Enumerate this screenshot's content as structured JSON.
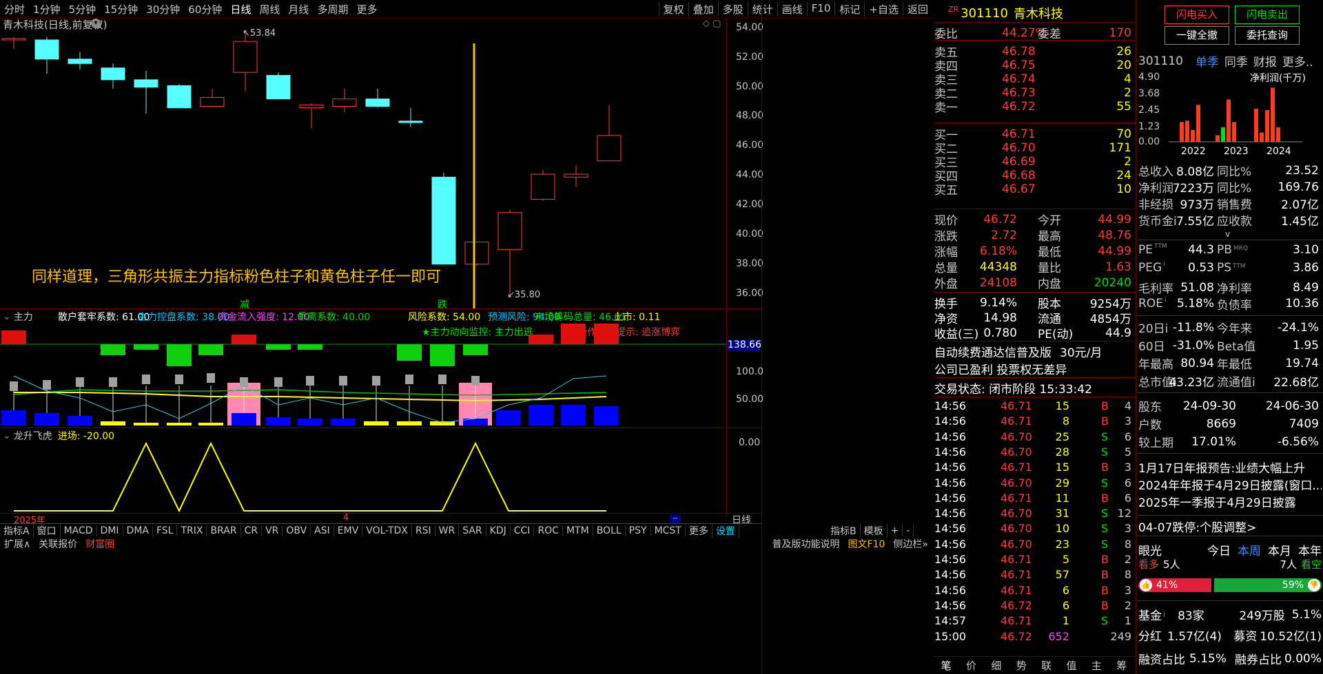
{
  "topbar": {
    "periods": [
      "分时",
      "1分钟",
      "5分钟",
      "15分钟",
      "30分钟",
      "60分钟",
      "日线",
      "周线",
      "月线",
      "多周期",
      "更多"
    ],
    "tools": [
      "复权",
      "叠加",
      "多股",
      "统计",
      "画线",
      "F10",
      "标记",
      "+自选",
      "返回"
    ]
  },
  "chart": {
    "title": "青木科技(日线,前复权)",
    "price_ticks": [
      "54.00",
      "52.00",
      "50.00",
      "48.00",
      "46.00",
      "44.00",
      "42.00",
      "40.00",
      "38.00",
      "36.00"
    ],
    "high_label": "53.84",
    "low_label": "35.80",
    "annotation": "同样道理，三角形共振主力指标粉色柱子和黄色柱子任一即可",
    "marker_jian": "减",
    "marker_die": "跌",
    "candles": [
      {
        "o": 53.2,
        "c": 53.3,
        "h": 53.4,
        "l": 52.6,
        "bull": true
      },
      {
        "o": 53.2,
        "c": 51.9,
        "h": 53.4,
        "l": 50.9,
        "bull": false
      },
      {
        "o": 51.9,
        "c": 51.6,
        "h": 52.4,
        "l": 51.2,
        "bull": false
      },
      {
        "o": 51.3,
        "c": 50.5,
        "h": 51.6,
        "l": 49.9,
        "bull": false
      },
      {
        "o": 50.5,
        "c": 50.0,
        "h": 51.1,
        "l": 48.2,
        "bull": false
      },
      {
        "o": 50.1,
        "c": 48.6,
        "h": 50.2,
        "l": 48.6,
        "bull": false
      },
      {
        "o": 48.7,
        "c": 49.3,
        "h": 49.9,
        "l": 48.7,
        "bull": true
      },
      {
        "o": 51.0,
        "c": 53.1,
        "h": 53.84,
        "l": 49.7,
        "bull": true
      },
      {
        "o": 50.8,
        "c": 49.2,
        "h": 51.0,
        "l": 49.2,
        "bull": false
      },
      {
        "o": 48.6,
        "c": 48.8,
        "h": 48.9,
        "l": 47.2,
        "bull": true
      },
      {
        "o": 48.7,
        "c": 49.2,
        "h": 49.9,
        "l": 48.3,
        "bull": true
      },
      {
        "o": 49.2,
        "c": 48.7,
        "h": 49.9,
        "l": 48.6,
        "bull": false
      },
      {
        "o": 47.7,
        "c": 47.6,
        "h": 48.6,
        "l": 47.3,
        "bull": false
      },
      {
        "o": 43.9,
        "c": 38.0,
        "h": 44.2,
        "l": 38.0,
        "bull": false
      },
      {
        "o": 38.0,
        "c": 39.5,
        "h": 39.5,
        "l": 37.9,
        "bull": true
      },
      {
        "o": 39.0,
        "c": 41.5,
        "h": 41.7,
        "l": 35.8,
        "bull": true
      },
      {
        "o": 42.4,
        "c": 44.1,
        "h": 44.4,
        "l": 42.3,
        "bull": true
      },
      {
        "o": 43.9,
        "c": 44.1,
        "h": 44.7,
        "l": 43.2,
        "bull": true
      },
      {
        "o": 45.0,
        "c": 46.72,
        "h": 48.76,
        "l": 44.99,
        "bull": true
      }
    ]
  },
  "indicator1": {
    "name": "主力",
    "items": [
      {
        "t": "散户套牢系数: 61.00",
        "c": "#ffffff"
      },
      {
        "t": "主力控盘系数: 38.00",
        "c": "#00c8ff"
      },
      {
        "t": "资金流入强度: 12.00",
        "c": "#ff40ff"
      },
      {
        "t": "乖离系数: 40.00",
        "c": "#00e000"
      },
      {
        "t": "风险系数: 54.00",
        "c": "#ffff00"
      },
      {
        "t": "预测风险: 94.00",
        "c": "#00c8ff"
      },
      {
        "t": "市场筹码总量: 46.61",
        "c": "#00e000"
      },
      {
        "t": "上市: 0.11",
        "c": "#ffff00"
      }
    ],
    "signal1": "★主力动向监控: 主力出逃",
    "signal2": "操作风险提示: 追涨博弈",
    "value_box": "138.66",
    "ticks": [
      "100.0",
      "50.00"
    ]
  },
  "indicator2": {
    "name": "龙升飞虎",
    "value": "进场: -20.00",
    "tick": "0.00"
  },
  "xaxis": {
    "year": "2025年",
    "month": "4"
  },
  "bottom_tabs": [
    "指标A",
    "窗口",
    "MACD",
    "DMI",
    "DMA",
    "FSL",
    "TRIX",
    "BRAR",
    "CR",
    "VR",
    "OBV",
    "ASI",
    "EMV",
    "VOL-TDX",
    "RSI",
    "WR",
    "SAR",
    "KDJ",
    "CCI",
    "ROC",
    "MTM",
    "BOLL",
    "PSY",
    "MCST",
    "更多",
    "设置"
  ],
  "bottom_right": [
    "指标B",
    "模板",
    "+",
    "-"
  ],
  "status_bar": {
    "left": [
      "扩展∧",
      "关联报价",
      "财富圈"
    ],
    "right": [
      "普及版功能说明",
      "图文F10",
      "侧边栏»"
    ],
    "period_btn": "日线"
  },
  "quote": {
    "badge": "ZR",
    "code": "301110",
    "name": "青木科技",
    "webi_label": "委比",
    "webi": "44.27%",
    "wecha_label": "委差",
    "wecha": "170",
    "sells": [
      {
        "l": "卖五",
        "p": "46.78",
        "v": "26"
      },
      {
        "l": "卖四",
        "p": "46.75",
        "v": "20"
      },
      {
        "l": "卖三",
        "p": "46.74",
        "v": "4"
      },
      {
        "l": "卖二",
        "p": "46.73",
        "v": "2"
      },
      {
        "l": "卖一",
        "p": "46.72",
        "v": "55"
      }
    ],
    "buys": [
      {
        "l": "买一",
        "p": "46.71",
        "v": "70"
      },
      {
        "l": "买二",
        "p": "46.70",
        "v": "171"
      },
      {
        "l": "买三",
        "p": "46.69",
        "v": "2"
      },
      {
        "l": "买四",
        "p": "46.68",
        "v": "24"
      },
      {
        "l": "买五",
        "p": "46.67",
        "v": "10"
      }
    ],
    "stats": [
      {
        "a": "现价",
        "av": "46.72",
        "ac": "#ff3c3c",
        "b": "今开",
        "bv": "44.99",
        "bc": "#ff3c3c"
      },
      {
        "a": "涨跌",
        "av": "2.72",
        "ac": "#ff3c3c",
        "b": "最高",
        "bv": "48.76",
        "bc": "#ff3c3c"
      },
      {
        "a": "涨幅",
        "av": "6.18%",
        "ac": "#ff3c3c",
        "b": "最低",
        "bv": "44.99",
        "bc": "#ff3c3c"
      },
      {
        "a": "总量",
        "av": "44348",
        "ac": "#ffff00",
        "b": "量比",
        "bv": "1.63",
        "bc": "#ff3c3c"
      },
      {
        "a": "外盘",
        "av": "24108",
        "ac": "#ff3c3c",
        "b": "内盘",
        "bv": "20240",
        "bc": "#00e000"
      }
    ],
    "stats2": [
      {
        "a": "换手",
        "av": "9.14%",
        "b": "股本",
        "bv": "9254万"
      },
      {
        "a": "净资",
        "av": "14.98",
        "b": "流通",
        "bv": "4854万"
      },
      {
        "a": "收益(三)",
        "av": "0.780",
        "b": "PE(动)",
        "bv": "44.9"
      }
    ],
    "notice1": "自动续费通达信普及版",
    "notice1b": "30元/月",
    "notice2": "公司已盈利 投票权无差异",
    "trade_status": "交易状态: 闭市阶段 15:33:42",
    "ticks": [
      {
        "t": "14:56",
        "p": "46.71",
        "v": "15",
        "s": "B",
        "n": "4"
      },
      {
        "t": "14:56",
        "p": "46.71",
        "v": "8",
        "s": "B",
        "n": "3"
      },
      {
        "t": "14:56",
        "p": "46.70",
        "v": "25",
        "s": "S",
        "n": "6"
      },
      {
        "t": "14:56",
        "p": "46.70",
        "v": "28",
        "s": "S",
        "n": "5"
      },
      {
        "t": "14:56",
        "p": "46.71",
        "v": "15",
        "s": "B",
        "n": "3"
      },
      {
        "t": "14:56",
        "p": "46.70",
        "v": "29",
        "s": "S",
        "n": "6"
      },
      {
        "t": "14:56",
        "p": "46.71",
        "v": "11",
        "s": "B",
        "n": "6"
      },
      {
        "t": "14:56",
        "p": "46.70",
        "v": "31",
        "s": "S",
        "n": "12"
      },
      {
        "t": "14:56",
        "p": "46.70",
        "v": "10",
        "s": "S",
        "n": "3"
      },
      {
        "t": "14:56",
        "p": "46.70",
        "v": "23",
        "s": "S",
        "n": "8"
      },
      {
        "t": "14:56",
        "p": "46.71",
        "v": "5",
        "s": "B",
        "n": "2"
      },
      {
        "t": "14:56",
        "p": "46.71",
        "v": "57",
        "s": "B",
        "n": "8"
      },
      {
        "t": "14:56",
        "p": "46.71",
        "v": "6",
        "s": "B",
        "n": "3"
      },
      {
        "t": "14:56",
        "p": "46.72",
        "v": "6",
        "s": "B",
        "n": "2"
      },
      {
        "t": "14:57",
        "p": "46.71",
        "v": "1",
        "s": "S",
        "n": "1"
      },
      {
        "t": "15:00",
        "p": "46.72",
        "v": "652",
        "s": "",
        "n": "249"
      }
    ],
    "bottom_tabs": [
      "笔",
      "价",
      "细",
      "势",
      "联",
      "值",
      "主",
      "筹"
    ]
  },
  "right": {
    "btn_buy": "闪电买入",
    "btn_sell": "闪电卖出",
    "btn_cancel": "一键全撤",
    "btn_query": "委托查询",
    "code": "301110",
    "tabs": [
      "单季",
      "同季",
      "财报",
      "更多.."
    ],
    "chart_ticks": [
      "4.90",
      "3.68",
      "2.45",
      "1.23",
      "0.00"
    ],
    "chart_label": "净利润(千万)",
    "years": [
      "2022",
      "2023",
      "2024"
    ],
    "bars": [
      1.5,
      1.6,
      0.9,
      2.8,
      0.5,
      1.1,
      3.2,
      1.5,
      2.5,
      0.7,
      2.4,
      4.1,
      1.1
    ],
    "fin": [
      {
        "a": "总收入",
        "av": "8.08亿",
        "b": "同比%",
        "bv": "23.52"
      },
      {
        "a": "净利润",
        "av": "7223万",
        "b": "同比%",
        "bv": "169.76"
      },
      {
        "a": "非经损",
        "av": "973万",
        "b": "销售费",
        "bv": "2.07亿"
      },
      {
        "a": "货币金i",
        "av": "7.55亿",
        "b": "应收款",
        "bv": "1.45亿"
      }
    ],
    "val": [
      {
        "a": "PE",
        "sa": "TTM",
        "av": "44.3",
        "b": "PB",
        "sb": "MRQ",
        "bv": "3.10"
      },
      {
        "a": "PEG",
        "sa": "i",
        "av": "0.53",
        "b": "PS",
        "sb": "TTM",
        "bv": "3.86"
      },
      {
        "a": "毛利率",
        "sa": "",
        "av": "51.08",
        "b": "净利率",
        "sb": "",
        "bv": "8.49"
      },
      {
        "a": "ROE",
        "sa": "i",
        "av": "5.18%",
        "b": "负债率",
        "sb": "",
        "bv": "10.36"
      }
    ],
    "perf": [
      {
        "a": "20日i",
        "av": "-11.8%",
        "b": "今年来",
        "bv": "-24.1%"
      },
      {
        "a": "60日",
        "av": "-31.0%",
        "b": "Beta值",
        "bv": "1.95"
      },
      {
        "a": "年最高",
        "av": "80.94",
        "b": "年最低",
        "bv": "19.74"
      },
      {
        "a": "总市值i",
        "av": "43.23亿",
        "b": "流通值i",
        "bv": "22.68亿"
      }
    ],
    "holders": [
      {
        "a": "股东",
        "av": "24-09-30",
        "bv": "24-06-30"
      },
      {
        "a": "户数",
        "av": "8669",
        "bv": "7409"
      },
      {
        "a": "较上期",
        "av": "17.01%",
        "bv": "-6.56%"
      }
    ],
    "news": [
      "1月17日年报预告:业绩大幅上升",
      "2024年年报于4月29日披露(窗口...",
      "2025年一季报于4月29日披露"
    ],
    "limit_note": "04-07跌停:个股调整>",
    "eye": "眼光",
    "eye_tabs": [
      "今日",
      "本周",
      "本月",
      "本年"
    ],
    "bull_label": "看多",
    "bull_n": "5人",
    "bear_n": "7人",
    "bear_label": "看空",
    "bull_pct": "41%",
    "bear_pct": "59%",
    "fund_label": "基金",
    "fund_icon": "i",
    "fund_n": "83家",
    "fund_shares": "249万股",
    "fund_pct": "5.1%",
    "div_label": "分红",
    "div_val": "1.57亿(4)",
    "raise_label": "募资",
    "raise_val": "10.52亿(1)",
    "margin_label": "融资占比",
    "margin_val": "5.15%",
    "short_label": "融券占比",
    "short_val": "0.00%"
  }
}
